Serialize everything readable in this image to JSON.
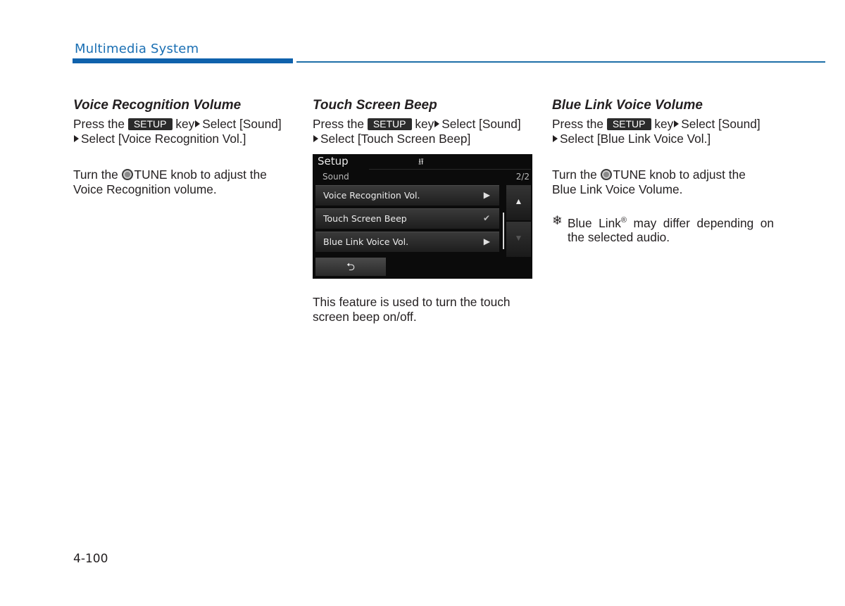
{
  "header": {
    "section_title": "Multimedia System"
  },
  "common": {
    "press_the": "Press the",
    "setup_key": "SETUP",
    "key_text": "key",
    "select_sound": "Select [Sound]",
    "turn_the": "Turn the",
    "tune_text": "TUNE knob to adjust the"
  },
  "columns": [
    {
      "heading": "Voice Recognition Volume",
      "select_item": "Select [Voice Recognition Vol.]",
      "tune_rest": "Voice Recognition volume."
    },
    {
      "heading": "Touch Screen Beep",
      "select_item": "Select [Touch Screen Beep]",
      "description": "This feature is used to turn the touch screen beep on/off."
    },
    {
      "heading": "Blue Link Voice Volume",
      "select_item": "Select [Blue Link Voice Vol.]",
      "tune_rest": "Blue Link Voice Volume.",
      "note_mark": "❄",
      "note_brand": "Blue Link",
      "note_reg": "®",
      "note_rest": " may differ depending on the selected audio."
    }
  ],
  "screen": {
    "title": "Setup",
    "usb_icon": "⭿",
    "subtitle": "Sound",
    "page": "2/2",
    "items": [
      {
        "label": "Voice Recognition Vol.",
        "icon": "▶"
      },
      {
        "label": "Touch Screen Beep",
        "icon": "✔"
      },
      {
        "label": "Blue Link Voice Vol.",
        "icon": "▶"
      }
    ],
    "up_icon": "▲",
    "down_icon": "▼",
    "back_icon": "⮌"
  },
  "footer": {
    "page_number": "4-100"
  }
}
